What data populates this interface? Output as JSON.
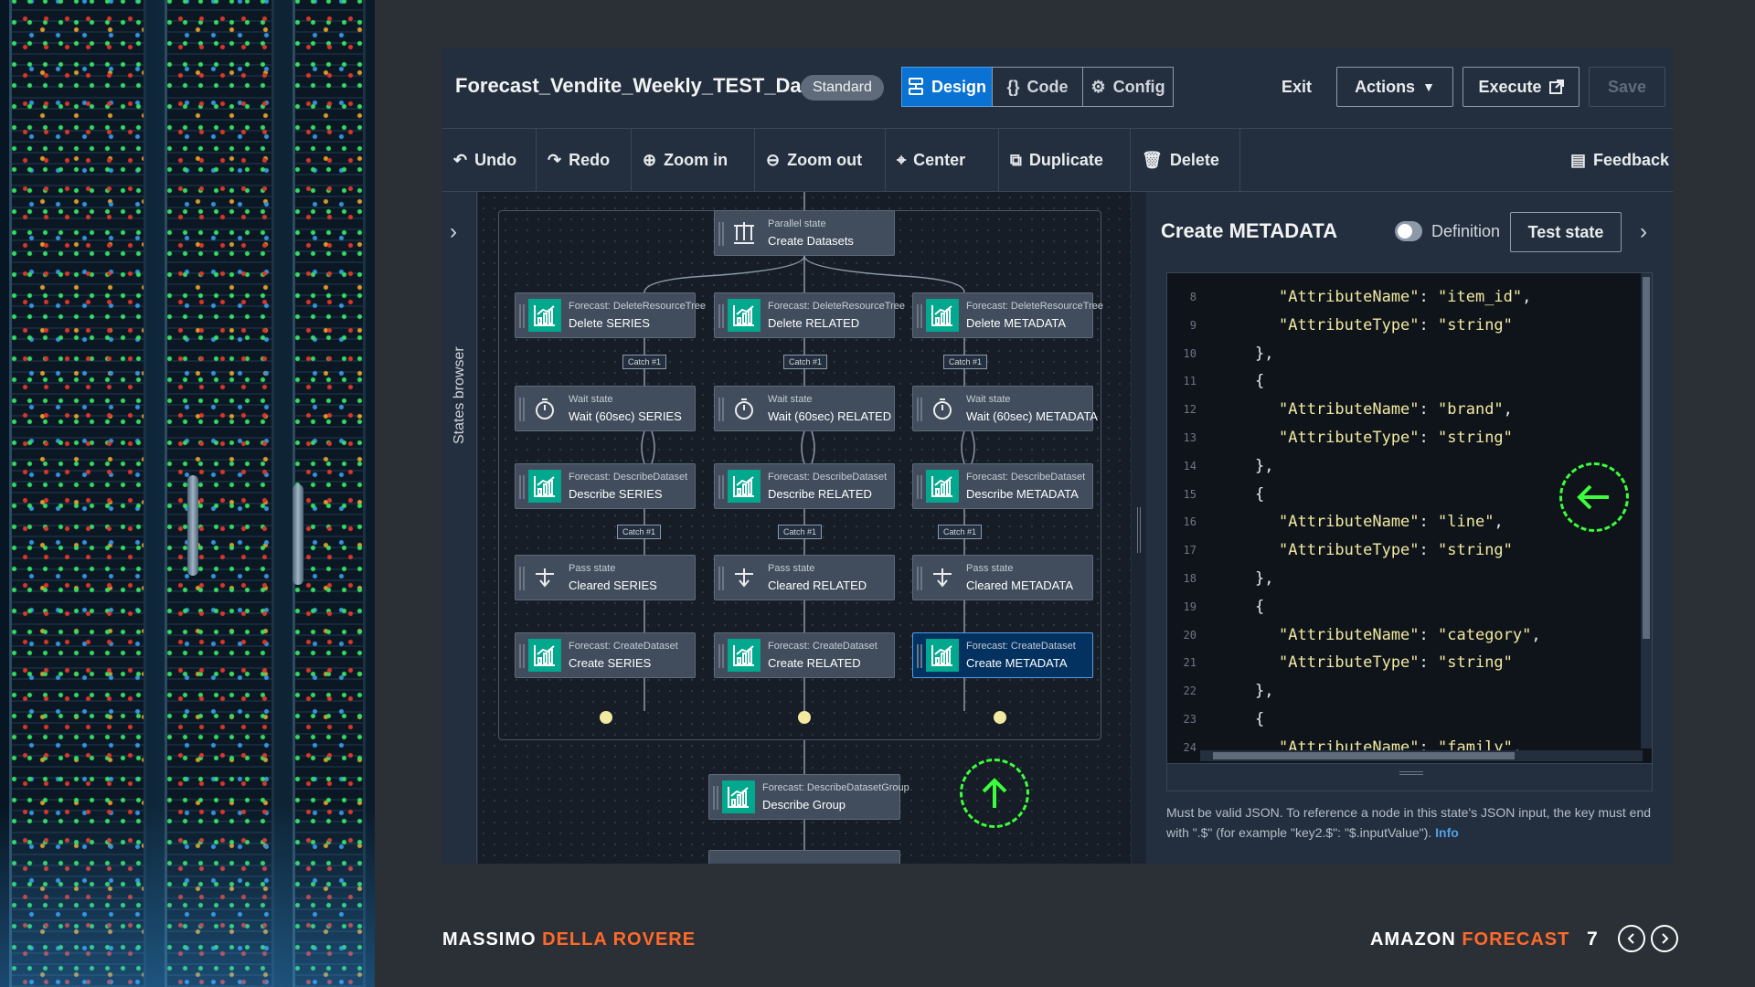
{
  "workflow": {
    "title": "Forecast_Vendite_Weekly_TEST_Da...",
    "badge": "Standard"
  },
  "modes": [
    {
      "label": "Design",
      "icon": "design-icon",
      "active": true
    },
    {
      "label": "Code",
      "icon": "braces-icon",
      "active": false
    },
    {
      "label": "Config",
      "icon": "gear-icon",
      "active": false
    }
  ],
  "header_actions": {
    "exit": "Exit",
    "actions": "Actions",
    "execute": "Execute",
    "save": "Save"
  },
  "toolbar": {
    "undo": "Undo",
    "redo": "Redo",
    "zoom_in": "Zoom in",
    "zoom_out": "Zoom out",
    "center": "Center",
    "duplicate": "Duplicate",
    "delete": "Delete",
    "feedback": "Feedback"
  },
  "states_browser": "States browser",
  "graph": {
    "parallel": {
      "type": "Parallel state",
      "name": "Create Datasets"
    },
    "catch_label": "Catch #1",
    "branches": [
      {
        "delete": {
          "type": "Forecast: DeleteResourceTree",
          "name": "Delete SERIES"
        },
        "wait": {
          "type": "Wait state",
          "name": "Wait (60sec) SERIES"
        },
        "describe": {
          "type": "Forecast: DescribeDataset",
          "name": "Describe SERIES"
        },
        "pass": {
          "type": "Pass state",
          "name": "Cleared SERIES"
        },
        "create": {
          "type": "Forecast: CreateDataset",
          "name": "Create SERIES"
        }
      },
      {
        "delete": {
          "type": "Forecast: DeleteResourceTree",
          "name": "Delete RELATED"
        },
        "wait": {
          "type": "Wait state",
          "name": "Wait (60sec) RELATED"
        },
        "describe": {
          "type": "Forecast: DescribeDataset",
          "name": "Describe RELATED"
        },
        "pass": {
          "type": "Pass state",
          "name": "Cleared RELATED"
        },
        "create": {
          "type": "Forecast: CreateDataset",
          "name": "Create RELATED"
        }
      },
      {
        "delete": {
          "type": "Forecast: DeleteResourceTree",
          "name": "Delete METADATA"
        },
        "wait": {
          "type": "Wait state",
          "name": "Wait (60sec) METADATA"
        },
        "describe": {
          "type": "Forecast: DescribeDataset",
          "name": "Describe METADATA"
        },
        "pass": {
          "type": "Pass state",
          "name": "Cleared METADATA"
        },
        "create": {
          "type": "Forecast: CreateDataset",
          "name": "Create METADATA",
          "selected": true
        }
      }
    ],
    "describe_group": {
      "type": "Forecast: DescribeDatasetGroup",
      "name": "Describe Group"
    }
  },
  "panel": {
    "title": "Create METADATA",
    "definition_label": "Definition",
    "test_state": "Test state",
    "code_lines": [
      {
        "n": "8",
        "indent": 1,
        "key": "\"AttributeName\"",
        "value": "\"item_id\"",
        "trail": ","
      },
      {
        "n": "9",
        "indent": 1,
        "key": "\"AttributeType\"",
        "value": "\"string\"",
        "trail": ""
      },
      {
        "n": "10",
        "indent": 0,
        "text": "},"
      },
      {
        "n": "11",
        "indent": 0,
        "text": "{"
      },
      {
        "n": "12",
        "indent": 1,
        "key": "\"AttributeName\"",
        "value": "\"brand\"",
        "trail": ","
      },
      {
        "n": "13",
        "indent": 1,
        "key": "\"AttributeType\"",
        "value": "\"string\"",
        "trail": ""
      },
      {
        "n": "14",
        "indent": 0,
        "text": "},"
      },
      {
        "n": "15",
        "indent": 0,
        "text": "{"
      },
      {
        "n": "16",
        "indent": 1,
        "key": "\"AttributeName\"",
        "value": "\"line\"",
        "trail": ","
      },
      {
        "n": "17",
        "indent": 1,
        "key": "\"AttributeType\"",
        "value": "\"string\"",
        "trail": ""
      },
      {
        "n": "18",
        "indent": 0,
        "text": "},"
      },
      {
        "n": "19",
        "indent": 0,
        "text": "{"
      },
      {
        "n": "20",
        "indent": 1,
        "key": "\"AttributeName\"",
        "value": "\"category\"",
        "trail": ","
      },
      {
        "n": "21",
        "indent": 1,
        "key": "\"AttributeType\"",
        "value": "\"string\"",
        "trail": ""
      },
      {
        "n": "22",
        "indent": 0,
        "text": "},"
      },
      {
        "n": "23",
        "indent": 0,
        "text": "{"
      },
      {
        "n": "24",
        "indent": 1,
        "key": "\"AttributeName\"",
        "value": "\"family\"",
        "trail": ","
      }
    ],
    "help_text": "Must be valid JSON. To reference a node in this state's JSON input, the key must end with \".$\" (for example \"key2.$\": \"$.inputValue\").",
    "info_link": "Info"
  },
  "footer": {
    "author_first": "MASSIMO",
    "author_last": "DELLA ROVERE",
    "topic_first": "AMAZON",
    "topic_last": "FORECAST",
    "page": "7"
  },
  "colors": {
    "accent_blue": "#0972d3",
    "forecast_green": "#01a88d",
    "highlight_green": "#3bff3b",
    "footer_orange": "#ff6a2a"
  }
}
